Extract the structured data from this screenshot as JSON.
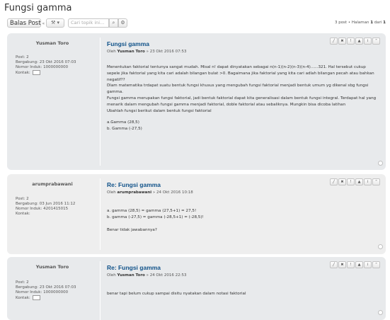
{
  "page": {
    "title": "Fungsi gamma"
  },
  "toolbar": {
    "reply_label": "Balas Post",
    "reply_icon": "«",
    "tools_icon": "⚒ ▾",
    "search_placeholder": "Cari topik ini...",
    "search_icon": "⌕",
    "advanced_icon": "⚙",
    "pagination_prefix": "3 post • Halaman ",
    "pagination_page": "1",
    "pagination_mid": " dari ",
    "pagination_total": "1"
  },
  "post_tools": [
    "╱",
    "✖",
    "!",
    "▲",
    "i",
    "“"
  ],
  "posts": [
    {
      "author": "Yusman Toro",
      "posts_label": "Post: 2",
      "joined": "Bergabung: 23 Okt 2016 07:03",
      "nim": "Nomor Induk: 1000000000",
      "contact": "Kontak:",
      "title": "Fungsi gamma",
      "by_prefix": "Oleh ",
      "by_user": "Yusman Toro",
      "by_date": " » 23 Okt 2016 07:53",
      "body": [
        "Menentukan faktorial tentunya sangat mudah. Misal n! dapat dinyatakan sebagai n(n-1)(n-2)(n-3)(n-4)......321. Hal tersebut cukup",
        "sepele jika faktorial yang kita cari adalah bilangan bulat >0. Bagaimana jika faktorial yang kita cari adlah bilangan pecah atau bahkan",
        "negatif??",
        "Dlam matematika trdapat suatu bentuk fungsi khusus yang mengubah fungsi faktorial menjadi bentuk umum yg dikenal sbg fungsi",
        "gamma.",
        "Fungsi gamma merupakan fungsi faktorial, jadi bentuk faktorial dapat kita generalisasi dalam bentuk fungsi integral. Terdapat hal yang",
        "menarik dalam mengubah fungsi gamma menjadi faktorial, doble faktorial atau sebaliknya. Mungkin bisa dicoba latihan",
        "Ubahlah fungsi berikut dalam bentuk fungsi faktorial",
        "",
        "a.Gamma (28,5)",
        "b. Gamma (-27,5)"
      ]
    },
    {
      "author": "arumprabawani",
      "posts_label": "Post: 2",
      "joined": "Bergabung: 03 Jun 2016 11:12",
      "nim": "Nomor Induk: 4201415015",
      "contact": "Kontak:",
      "title": "Re: Fungsi gamma",
      "by_prefix": "Oleh ",
      "by_user": "arumprabawani",
      "by_date": " » 24 Okt 2016 10:18",
      "body": [
        "a. gamma (28,5) = gamma (27,5+1) = 27,5!",
        "b. gamma (-27,5) = gamma (-28,5+1) = (-28,5)!",
        "",
        "Benar tidak jawabannya?"
      ]
    },
    {
      "author": "Yusman Toro",
      "posts_label": "Post: 2",
      "joined": "Bergabung: 23 Okt 2016 07:03",
      "nim": "Nomor Induk: 1000000000",
      "contact": "Kontak:",
      "title": "Re: Fungsi gamma",
      "by_prefix": "Oleh ",
      "by_user": "Yusman Toro",
      "by_date": " » 24 Okt 2016 22:53",
      "body": [
        "benar tapi belum cukup sampai disitu nyatakan dalam notasi faktorial"
      ]
    }
  ]
}
